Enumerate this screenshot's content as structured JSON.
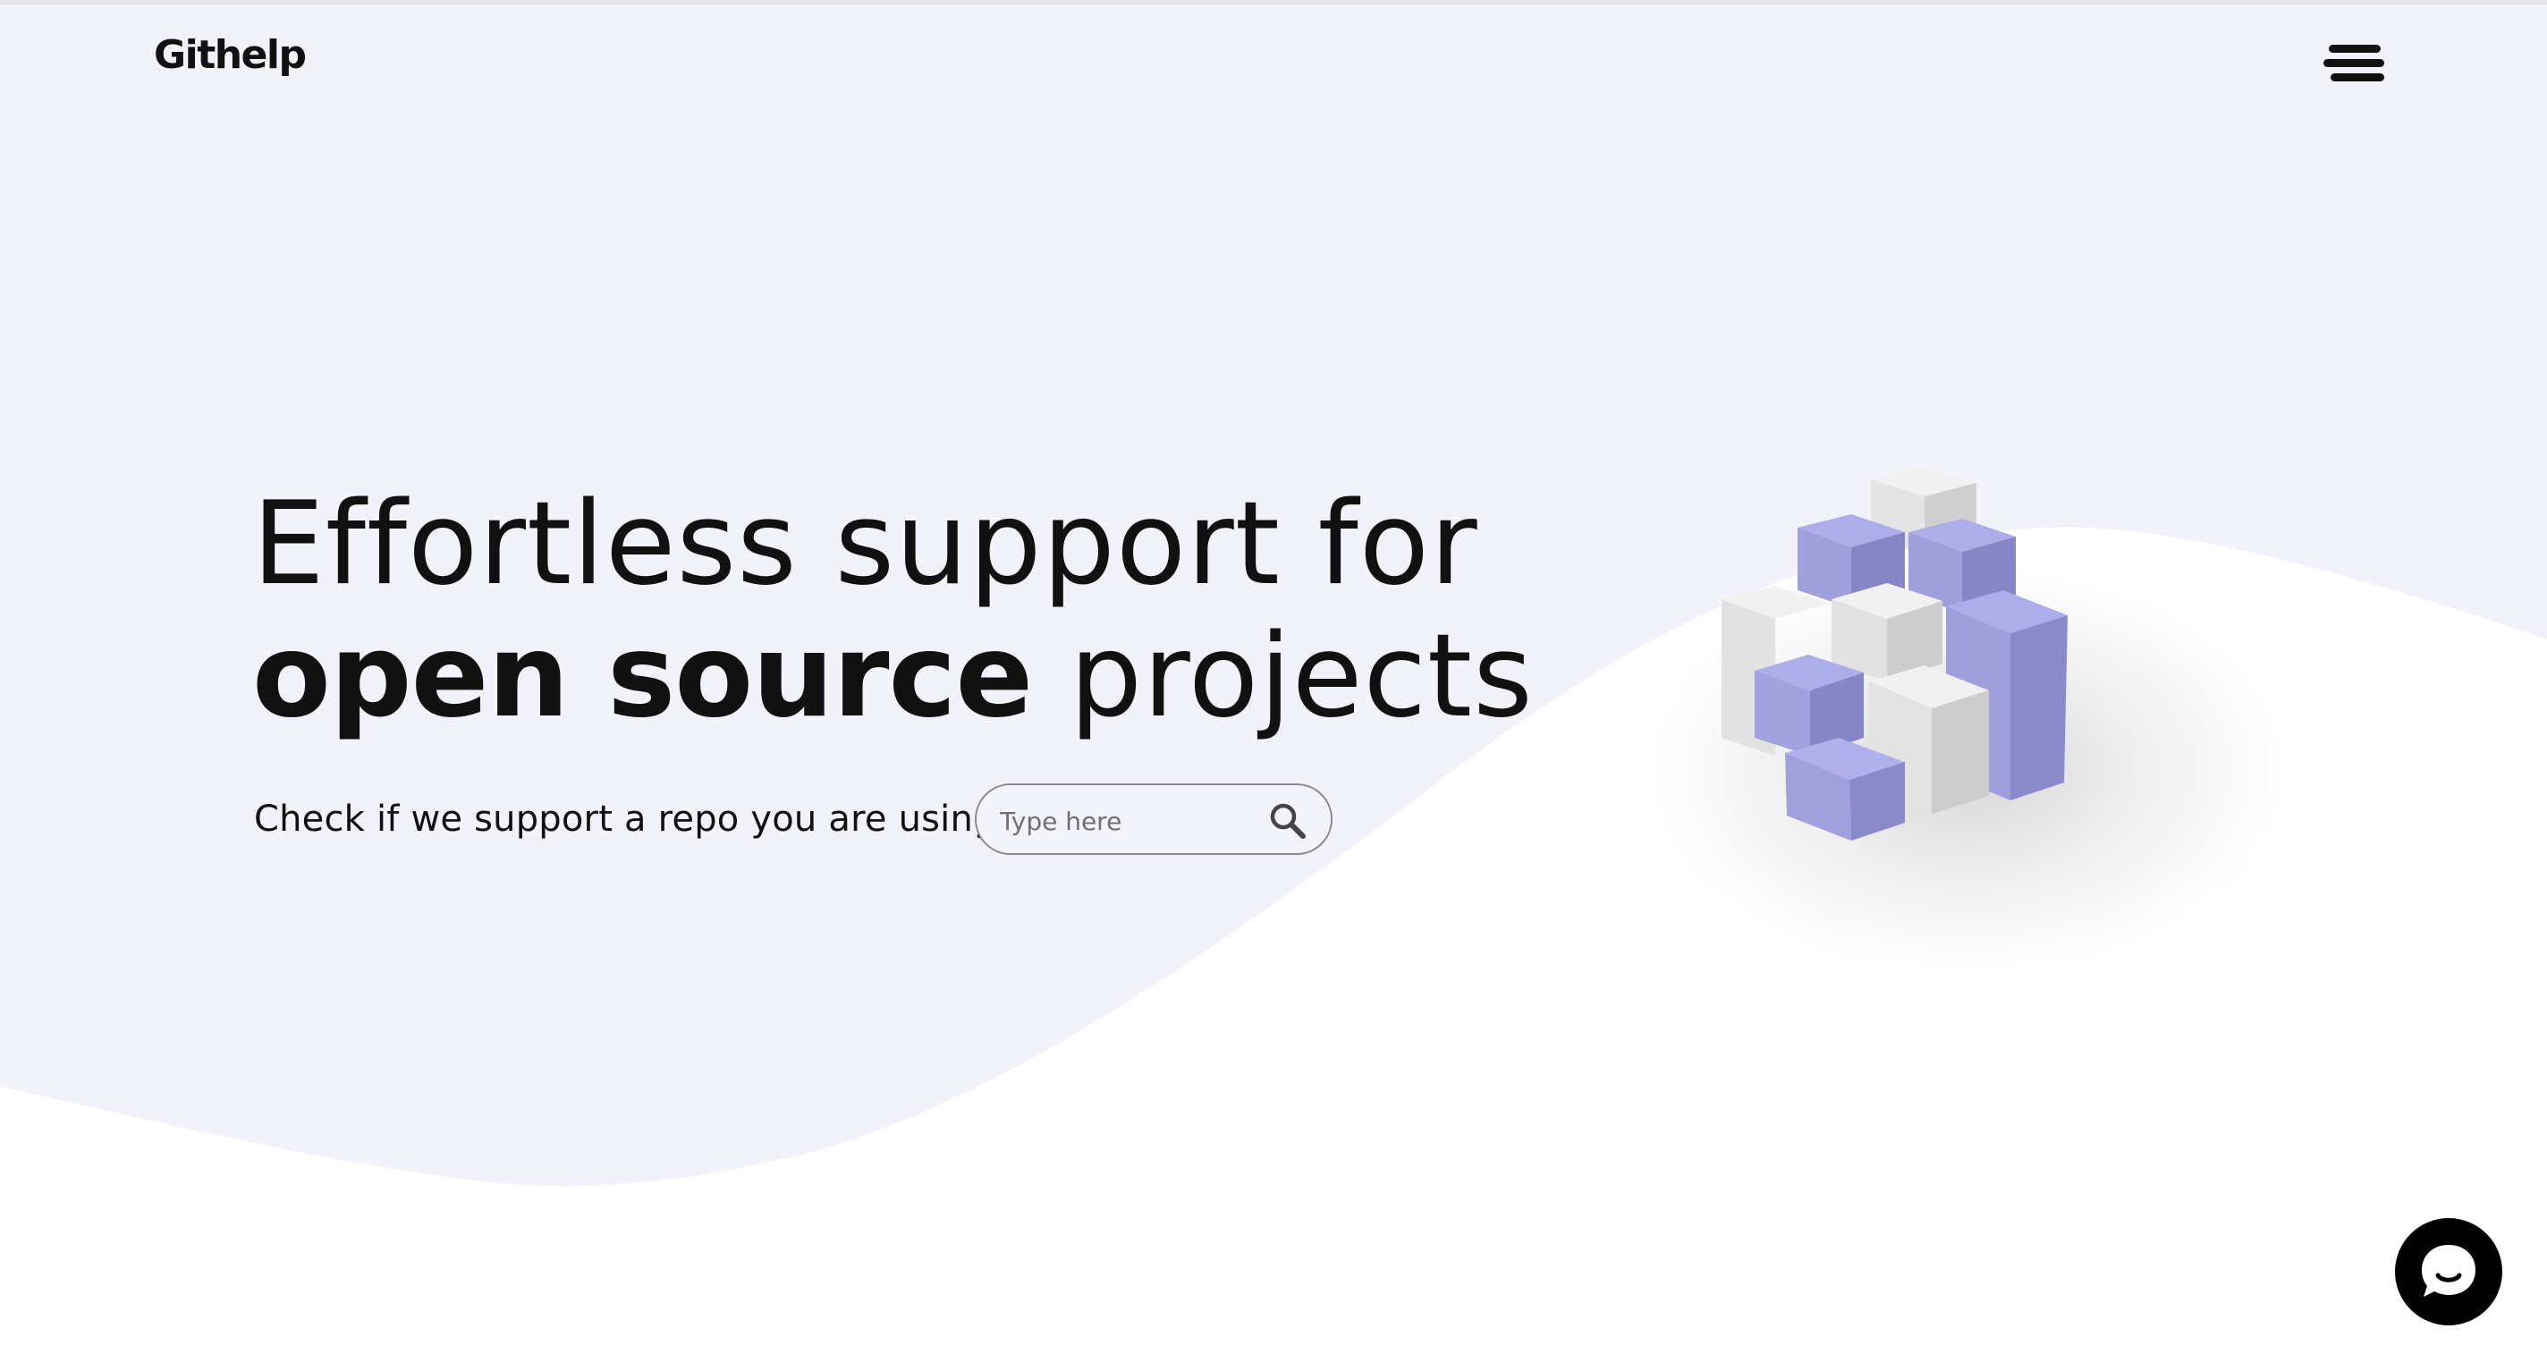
{
  "header": {
    "logo_text": "Githelp",
    "menu_icon": "hamburger-menu-icon"
  },
  "hero": {
    "title_line1": "Effortless support for",
    "title_line2_bold": "open source",
    "title_line2_rest": " projects",
    "check_text": "Check if we support a repo you are using"
  },
  "search": {
    "placeholder": "Type here",
    "value": "",
    "icon": "search-icon"
  },
  "chat": {
    "icon": "chat-bubble-icon"
  },
  "colors": {
    "background_lavender": "#f2f2fb",
    "background_white": "#ffffff",
    "cube_purple": "#a3a3dd",
    "cube_white": "#e9e9e9",
    "text": "#111111",
    "chat_button": "#000000"
  }
}
